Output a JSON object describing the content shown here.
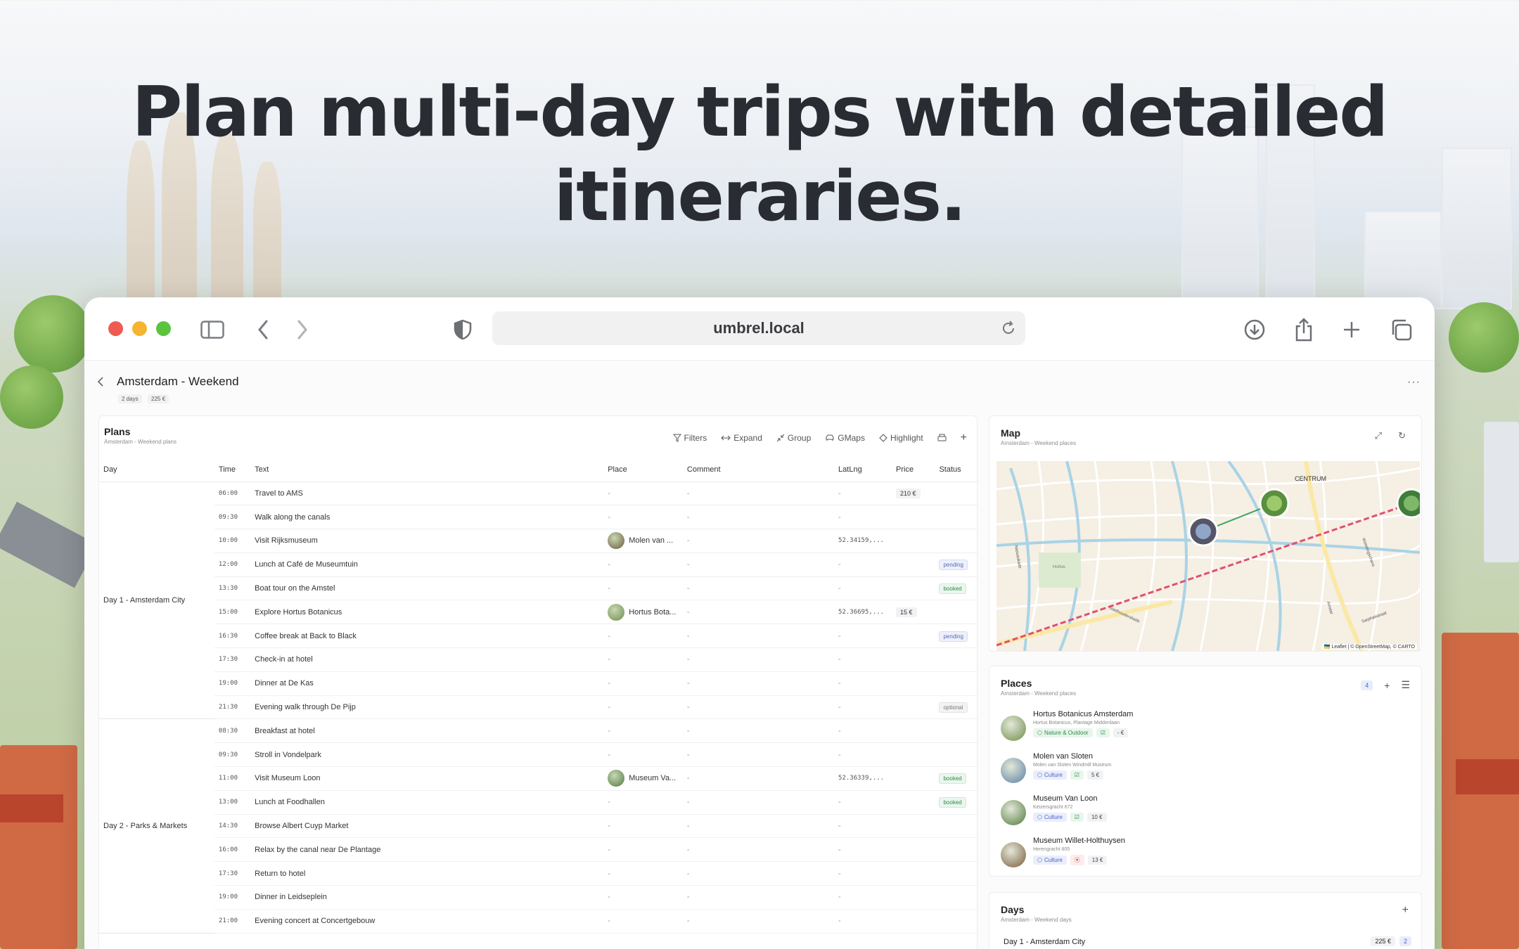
{
  "hero": {
    "title": "Plan multi-day trips with detailed itineraries."
  },
  "browser": {
    "url": "umbrel.local"
  },
  "trip": {
    "title": "Amsterdam - Weekend",
    "duration": "2 days",
    "budget": "225 €"
  },
  "plans": {
    "title": "Plans",
    "subtitle": "Amsterdam - Weekend plans",
    "actions": {
      "filters": "Filters",
      "expand": "Expand",
      "group": "Group",
      "gmaps": "GMaps",
      "highlight": "Highlight"
    },
    "columns": [
      "Day",
      "Time",
      "Text",
      "Place",
      "Comment",
      "LatLng",
      "Price",
      "Status"
    ],
    "day_groups": [
      {
        "day": "Day 1 - Amsterdam City",
        "rows": [
          {
            "time": "06:00",
            "text": "Travel to AMS",
            "place": "-",
            "comment": "-",
            "latlng": "-",
            "price": "210 €",
            "status": ""
          },
          {
            "time": "09:30",
            "text": "Walk along the canals",
            "place": "-",
            "comment": "-",
            "latlng": "-",
            "price": "",
            "status": ""
          },
          {
            "time": "10:00",
            "text": "Visit Rijksmuseum",
            "place": "Molen van ...",
            "comment": "-",
            "latlng": "52.34159,...",
            "price": "",
            "status": ""
          },
          {
            "time": "12:00",
            "text": "Lunch at Café de Museumtuin",
            "place": "-",
            "comment": "-",
            "latlng": "-",
            "price": "",
            "status": "pending"
          },
          {
            "time": "13:30",
            "text": "Boat tour on the Amstel",
            "place": "-",
            "comment": "-",
            "latlng": "-",
            "price": "",
            "status": "booked"
          },
          {
            "time": "15:00",
            "text": "Explore Hortus Botanicus",
            "place": "Hortus Bota...",
            "comment": "-",
            "latlng": "52.36695,...",
            "price": "15 €",
            "status": ""
          },
          {
            "time": "16:30",
            "text": "Coffee break at Back to Black",
            "place": "-",
            "comment": "-",
            "latlng": "-",
            "price": "",
            "status": "pending"
          },
          {
            "time": "17:30",
            "text": "Check-in at hotel",
            "place": "-",
            "comment": "-",
            "latlng": "-",
            "price": "",
            "status": ""
          },
          {
            "time": "19:00",
            "text": "Dinner at De Kas",
            "place": "-",
            "comment": "-",
            "latlng": "-",
            "price": "",
            "status": ""
          },
          {
            "time": "21:30",
            "text": "Evening walk through De Pijp",
            "place": "-",
            "comment": "-",
            "latlng": "-",
            "price": "",
            "status": "optional"
          }
        ]
      },
      {
        "day": "Day 2 - Parks & Markets",
        "rows": [
          {
            "time": "08:30",
            "text": "Breakfast at hotel",
            "place": "-",
            "comment": "-",
            "latlng": "-",
            "price": "",
            "status": ""
          },
          {
            "time": "09:30",
            "text": "Stroll in Vondelpark",
            "place": "-",
            "comment": "-",
            "latlng": "-",
            "price": "",
            "status": ""
          },
          {
            "time": "11:00",
            "text": "Visit Museum Loon",
            "place": "Museum Va...",
            "comment": "-",
            "latlng": "52.36339,...",
            "price": "",
            "status": "booked"
          },
          {
            "time": "13:00",
            "text": "Lunch at Foodhallen",
            "place": "-",
            "comment": "-",
            "latlng": "-",
            "price": "",
            "status": "booked"
          },
          {
            "time": "14:30",
            "text": "Browse Albert Cuyp Market",
            "place": "-",
            "comment": "-",
            "latlng": "-",
            "price": "",
            "status": ""
          },
          {
            "time": "16:00",
            "text": "Relax by the canal near De Plantage",
            "place": "-",
            "comment": "-",
            "latlng": "-",
            "price": "",
            "status": ""
          },
          {
            "time": "17:30",
            "text": "Return to hotel",
            "place": "-",
            "comment": "-",
            "latlng": "-",
            "price": "",
            "status": ""
          },
          {
            "time": "19:00",
            "text": "Dinner in Leidseplein",
            "place": "-",
            "comment": "-",
            "latlng": "-",
            "price": "",
            "status": ""
          },
          {
            "time": "21:00",
            "text": "Evening concert at Concertgebouw",
            "place": "-",
            "comment": "-",
            "latlng": "-",
            "price": "",
            "status": ""
          }
        ]
      }
    ]
  },
  "map": {
    "title": "Map",
    "subtitle": "Amsterdam - Weekend places",
    "labels": [
      "CENTRUM",
      "Hortus",
      "Nassaukade",
      "Weteringschans",
      "Stadhouderskade",
      "Sarphatistraat",
      "Amstel"
    ],
    "attribution": "🇺🇦 Leaflet | © OpenStreetMap, © CARTO"
  },
  "places": {
    "title": "Places",
    "subtitle": "Amsterdam - Weekend places",
    "count": "4",
    "items": [
      {
        "name": "Hortus Botanicus Amsterdam",
        "address": "Hortus Botanicus, Plantage Middenlaan",
        "category": "Nature & Outdoor",
        "price": "- €",
        "cat_color": "green",
        "status_icon": "check"
      },
      {
        "name": "Molen van Sloten",
        "address": "Molen van Sloten Windmill Museum",
        "category": "Culture",
        "price": "5 €",
        "cat_color": "blue",
        "status_icon": "check"
      },
      {
        "name": "Museum Van Loon",
        "address": "Keizersgracht 672",
        "category": "Culture",
        "price": "10 €",
        "cat_color": "blue",
        "status_icon": "check"
      },
      {
        "name": "Museum Willet-Holthuysen",
        "address": "Herengracht 605",
        "category": "Culture",
        "price": "13 €",
        "cat_color": "blue",
        "status_icon": "pin"
      }
    ]
  },
  "days": {
    "title": "Days",
    "subtitle": "Amsterdam - Weekend days",
    "items": [
      {
        "name": "Day 1 - Amsterdam City",
        "price": "225 €",
        "count": "2"
      }
    ]
  },
  "colors": {
    "accent": "#4a63c4",
    "green": "#2f8a47",
    "route": "#e0506e"
  }
}
